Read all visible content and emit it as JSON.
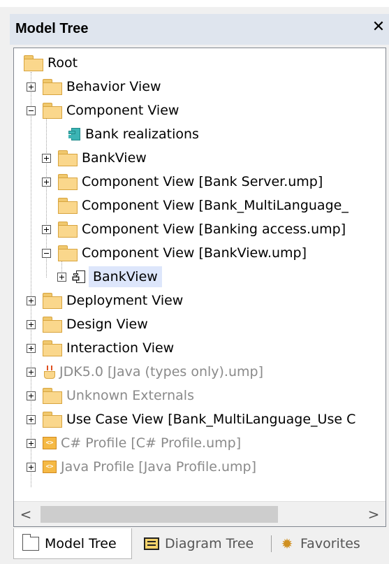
{
  "window": {
    "title": "Model Tree",
    "close_glyph": "✕"
  },
  "tree": {
    "root": {
      "label": "Root",
      "icon": "folder-icon"
    },
    "items": [
      {
        "label": "Behavior View",
        "toggle": "plus",
        "icon": "folder-icon",
        "grey": false
      },
      {
        "label": "Component View",
        "toggle": "minus",
        "icon": "folder-icon",
        "grey": false
      },
      {
        "label": "Bank realizations",
        "toggle": "none",
        "icon": "component-icon",
        "grey": false
      },
      {
        "label": "BankView",
        "toggle": "plus",
        "icon": "folder-icon",
        "grey": false
      },
      {
        "label": "Component View [Bank Server.ump]",
        "toggle": "plus",
        "icon": "folder-icon",
        "grey": false
      },
      {
        "label": "Component View [Bank_MultiLanguage_",
        "toggle": "none",
        "icon": "folder-icon",
        "grey": false
      },
      {
        "label": "Component View [Banking access.ump]",
        "toggle": "plus",
        "icon": "folder-icon",
        "grey": false
      },
      {
        "label": "Component View [BankView.ump]",
        "toggle": "minus",
        "icon": "folder-icon",
        "grey": false
      },
      {
        "label": "BankView",
        "toggle": "plus",
        "icon": "component-outline-icon",
        "grey": false,
        "selected": true
      },
      {
        "label": "Deployment View",
        "toggle": "plus",
        "icon": "folder-icon",
        "grey": false
      },
      {
        "label": "Design View",
        "toggle": "plus",
        "icon": "folder-icon",
        "grey": false
      },
      {
        "label": "Interaction View",
        "toggle": "plus",
        "icon": "folder-icon",
        "grey": false
      },
      {
        "label": "JDK5.0 [Java (types only).ump]",
        "toggle": "plus",
        "icon": "java-icon",
        "grey": true
      },
      {
        "label": "Unknown Externals",
        "toggle": "plus",
        "icon": "folder-icon",
        "grey": true
      },
      {
        "label": "Use Case View [Bank_MultiLanguage_Use C",
        "toggle": "plus",
        "icon": "folder-icon",
        "grey": false
      },
      {
        "label": "C# Profile [C# Profile.ump]",
        "toggle": "plus",
        "icon": "profile-icon",
        "grey": true
      },
      {
        "label": "Java Profile [Java Profile.ump]",
        "toggle": "plus",
        "icon": "profile-icon",
        "grey": true
      }
    ]
  },
  "scrollbar": {
    "left_glyph": "<",
    "right_glyph": ">"
  },
  "tabs": [
    {
      "label": "Model Tree",
      "icon": "folder-icon",
      "active": true
    },
    {
      "label": "Diagram Tree",
      "icon": "diagram-icon",
      "active": false
    },
    {
      "label": "Favorites",
      "icon": "favorites-icon",
      "active": false
    }
  ],
  "profile_icon_glyph": "<>",
  "favorites_glyph": "✹",
  "colors": {
    "titlebar": "#dfe5ee",
    "selection": "#dde6fb",
    "folder": "#fad78c",
    "component": "#3cb4b4",
    "grey_text": "#8a8a8a"
  }
}
